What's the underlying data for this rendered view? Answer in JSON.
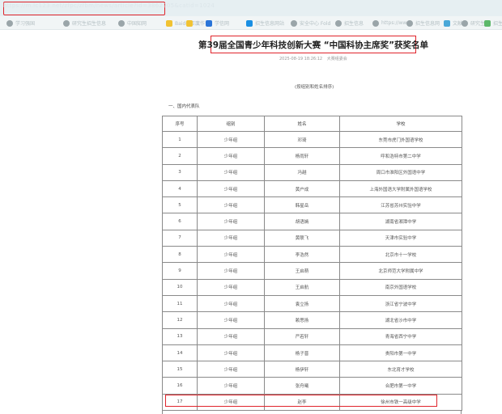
{
  "colors": {
    "highlight": "#e0242b"
  },
  "browser": {
    "url": "https://m.lc123.net/zfpc/zfbm/news/article?id=3862905&catid=1024",
    "bookmarks": [
      {
        "icon": "globe-icon",
        "label": "学习强国",
        "color": "#9aa5a9"
      },
      {
        "icon": "shield-icon",
        "label": "研究生招生信息",
        "color": "#9aa5a9"
      },
      {
        "icon": "shield-icon",
        "label": "中国知网",
        "color": "#9aa5a9"
      },
      {
        "icon": "folder-icon",
        "label": "Baidu 百度",
        "color": "#f1c232"
      },
      {
        "icon": "folder-icon",
        "label": "工作台",
        "color": "#f1c232"
      },
      {
        "icon": "app-icon",
        "label": "学信网",
        "color": "#2a74d8"
      },
      {
        "icon": "app-icon",
        "label": "招生信息网站",
        "color": "#1a8fe3"
      },
      {
        "icon": "shield-icon",
        "label": "安全中心 Fold",
        "color": "#9aa5a9"
      },
      {
        "icon": "shield-icon",
        "label": "招生信息",
        "color": "#9aa5a9"
      },
      {
        "icon": "globe-icon",
        "label": "https://www.",
        "color": "#9aa5a9"
      },
      {
        "icon": "globe-icon",
        "label": "招生信息网",
        "color": "#9aa5a9"
      },
      {
        "icon": "grid-icon",
        "label": "文献",
        "color": "#4aa8d8"
      },
      {
        "icon": "globe-icon",
        "label": "研究生",
        "color": "#9aa5a9"
      },
      {
        "icon": "app-icon",
        "label": "招生",
        "color": "#5db86a"
      }
    ]
  },
  "article": {
    "title": "第39届全国青少年科技创新大赛 “中国科协主席奖”获奖名单",
    "date": "2025-08-19 18:26:12",
    "source": "大赛组委会",
    "note": "(按组别和姓名排序)",
    "section_heading": "一、国内代表队",
    "table": {
      "headers": [
        "序号",
        "组别",
        "姓名",
        "学校"
      ],
      "rows": [
        [
          "1",
          "少年组",
          "邓琦",
          "东莞市虎门外国语学校"
        ],
        [
          "2",
          "少年组",
          "杨雨轩",
          "呼和浩特市第二中学"
        ],
        [
          "3",
          "少年组",
          "冯越",
          "周口市淮阳区外国语中学"
        ],
        [
          "4",
          "少年组",
          "黄户成",
          "上海外国语大学附属外国语学校"
        ],
        [
          "5",
          "少年组",
          "韩星岳",
          "江苏省苏州实验中学"
        ],
        [
          "6",
          "少年组",
          "胡语嫣",
          "湖南省湘潭中学"
        ],
        [
          "7",
          "少年组",
          "黄联飞",
          "天津市实验中学"
        ],
        [
          "8",
          "少年组",
          "李浩然",
          "北京市十一学校"
        ],
        [
          "9",
          "少年组",
          "王启萌",
          "北京师范大学附属中学"
        ],
        [
          "10",
          "少年组",
          "王启航",
          "南京外国语学校"
        ],
        [
          "11",
          "少年组",
          "袁立扬",
          "浙江省宁波中学"
        ],
        [
          "12",
          "少年组",
          "赖思扬",
          "湖北省沙市中学"
        ],
        [
          "13",
          "少年组",
          "严若轩",
          "青海省西宁中学"
        ],
        [
          "14",
          "少年组",
          "杨子晋",
          "贵阳市第一中学"
        ],
        [
          "15",
          "少年组",
          "杨伊轩",
          "东北育才学校"
        ],
        [
          "16",
          "少年组",
          "张舟曦",
          "合肥市第一中学"
        ],
        [
          "17",
          "少年组",
          "赵李",
          "徐州市铁一高级中学"
        ]
      ]
    }
  }
}
